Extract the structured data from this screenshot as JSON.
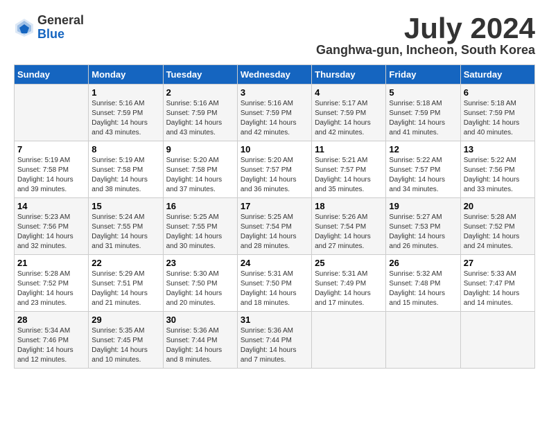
{
  "logo": {
    "general": "General",
    "blue": "Blue"
  },
  "title": "July 2024",
  "location": "Ganghwa-gun, Incheon, South Korea",
  "days_of_week": [
    "Sunday",
    "Monday",
    "Tuesday",
    "Wednesday",
    "Thursday",
    "Friday",
    "Saturday"
  ],
  "weeks": [
    [
      {
        "day": "",
        "sunrise": "",
        "sunset": "",
        "daylight": ""
      },
      {
        "day": "1",
        "sunrise": "Sunrise: 5:16 AM",
        "sunset": "Sunset: 7:59 PM",
        "daylight": "Daylight: 14 hours and 43 minutes."
      },
      {
        "day": "2",
        "sunrise": "Sunrise: 5:16 AM",
        "sunset": "Sunset: 7:59 PM",
        "daylight": "Daylight: 14 hours and 43 minutes."
      },
      {
        "day": "3",
        "sunrise": "Sunrise: 5:16 AM",
        "sunset": "Sunset: 7:59 PM",
        "daylight": "Daylight: 14 hours and 42 minutes."
      },
      {
        "day": "4",
        "sunrise": "Sunrise: 5:17 AM",
        "sunset": "Sunset: 7:59 PM",
        "daylight": "Daylight: 14 hours and 42 minutes."
      },
      {
        "day": "5",
        "sunrise": "Sunrise: 5:18 AM",
        "sunset": "Sunset: 7:59 PM",
        "daylight": "Daylight: 14 hours and 41 minutes."
      },
      {
        "day": "6",
        "sunrise": "Sunrise: 5:18 AM",
        "sunset": "Sunset: 7:59 PM",
        "daylight": "Daylight: 14 hours and 40 minutes."
      }
    ],
    [
      {
        "day": "7",
        "sunrise": "Sunrise: 5:19 AM",
        "sunset": "Sunset: 7:58 PM",
        "daylight": "Daylight: 14 hours and 39 minutes."
      },
      {
        "day": "8",
        "sunrise": "Sunrise: 5:19 AM",
        "sunset": "Sunset: 7:58 PM",
        "daylight": "Daylight: 14 hours and 38 minutes."
      },
      {
        "day": "9",
        "sunrise": "Sunrise: 5:20 AM",
        "sunset": "Sunset: 7:58 PM",
        "daylight": "Daylight: 14 hours and 37 minutes."
      },
      {
        "day": "10",
        "sunrise": "Sunrise: 5:20 AM",
        "sunset": "Sunset: 7:57 PM",
        "daylight": "Daylight: 14 hours and 36 minutes."
      },
      {
        "day": "11",
        "sunrise": "Sunrise: 5:21 AM",
        "sunset": "Sunset: 7:57 PM",
        "daylight": "Daylight: 14 hours and 35 minutes."
      },
      {
        "day": "12",
        "sunrise": "Sunrise: 5:22 AM",
        "sunset": "Sunset: 7:57 PM",
        "daylight": "Daylight: 14 hours and 34 minutes."
      },
      {
        "day": "13",
        "sunrise": "Sunrise: 5:22 AM",
        "sunset": "Sunset: 7:56 PM",
        "daylight": "Daylight: 14 hours and 33 minutes."
      }
    ],
    [
      {
        "day": "14",
        "sunrise": "Sunrise: 5:23 AM",
        "sunset": "Sunset: 7:56 PM",
        "daylight": "Daylight: 14 hours and 32 minutes."
      },
      {
        "day": "15",
        "sunrise": "Sunrise: 5:24 AM",
        "sunset": "Sunset: 7:55 PM",
        "daylight": "Daylight: 14 hours and 31 minutes."
      },
      {
        "day": "16",
        "sunrise": "Sunrise: 5:25 AM",
        "sunset": "Sunset: 7:55 PM",
        "daylight": "Daylight: 14 hours and 30 minutes."
      },
      {
        "day": "17",
        "sunrise": "Sunrise: 5:25 AM",
        "sunset": "Sunset: 7:54 PM",
        "daylight": "Daylight: 14 hours and 28 minutes."
      },
      {
        "day": "18",
        "sunrise": "Sunrise: 5:26 AM",
        "sunset": "Sunset: 7:54 PM",
        "daylight": "Daylight: 14 hours and 27 minutes."
      },
      {
        "day": "19",
        "sunrise": "Sunrise: 5:27 AM",
        "sunset": "Sunset: 7:53 PM",
        "daylight": "Daylight: 14 hours and 26 minutes."
      },
      {
        "day": "20",
        "sunrise": "Sunrise: 5:28 AM",
        "sunset": "Sunset: 7:52 PM",
        "daylight": "Daylight: 14 hours and 24 minutes."
      }
    ],
    [
      {
        "day": "21",
        "sunrise": "Sunrise: 5:28 AM",
        "sunset": "Sunset: 7:52 PM",
        "daylight": "Daylight: 14 hours and 23 minutes."
      },
      {
        "day": "22",
        "sunrise": "Sunrise: 5:29 AM",
        "sunset": "Sunset: 7:51 PM",
        "daylight": "Daylight: 14 hours and 21 minutes."
      },
      {
        "day": "23",
        "sunrise": "Sunrise: 5:30 AM",
        "sunset": "Sunset: 7:50 PM",
        "daylight": "Daylight: 14 hours and 20 minutes."
      },
      {
        "day": "24",
        "sunrise": "Sunrise: 5:31 AM",
        "sunset": "Sunset: 7:50 PM",
        "daylight": "Daylight: 14 hours and 18 minutes."
      },
      {
        "day": "25",
        "sunrise": "Sunrise: 5:31 AM",
        "sunset": "Sunset: 7:49 PM",
        "daylight": "Daylight: 14 hours and 17 minutes."
      },
      {
        "day": "26",
        "sunrise": "Sunrise: 5:32 AM",
        "sunset": "Sunset: 7:48 PM",
        "daylight": "Daylight: 14 hours and 15 minutes."
      },
      {
        "day": "27",
        "sunrise": "Sunrise: 5:33 AM",
        "sunset": "Sunset: 7:47 PM",
        "daylight": "Daylight: 14 hours and 14 minutes."
      }
    ],
    [
      {
        "day": "28",
        "sunrise": "Sunrise: 5:34 AM",
        "sunset": "Sunset: 7:46 PM",
        "daylight": "Daylight: 14 hours and 12 minutes."
      },
      {
        "day": "29",
        "sunrise": "Sunrise: 5:35 AM",
        "sunset": "Sunset: 7:45 PM",
        "daylight": "Daylight: 14 hours and 10 minutes."
      },
      {
        "day": "30",
        "sunrise": "Sunrise: 5:36 AM",
        "sunset": "Sunset: 7:44 PM",
        "daylight": "Daylight: 14 hours and 8 minutes."
      },
      {
        "day": "31",
        "sunrise": "Sunrise: 5:36 AM",
        "sunset": "Sunset: 7:44 PM",
        "daylight": "Daylight: 14 hours and 7 minutes."
      },
      {
        "day": "",
        "sunrise": "",
        "sunset": "",
        "daylight": ""
      },
      {
        "day": "",
        "sunrise": "",
        "sunset": "",
        "daylight": ""
      },
      {
        "day": "",
        "sunrise": "",
        "sunset": "",
        "daylight": ""
      }
    ]
  ]
}
